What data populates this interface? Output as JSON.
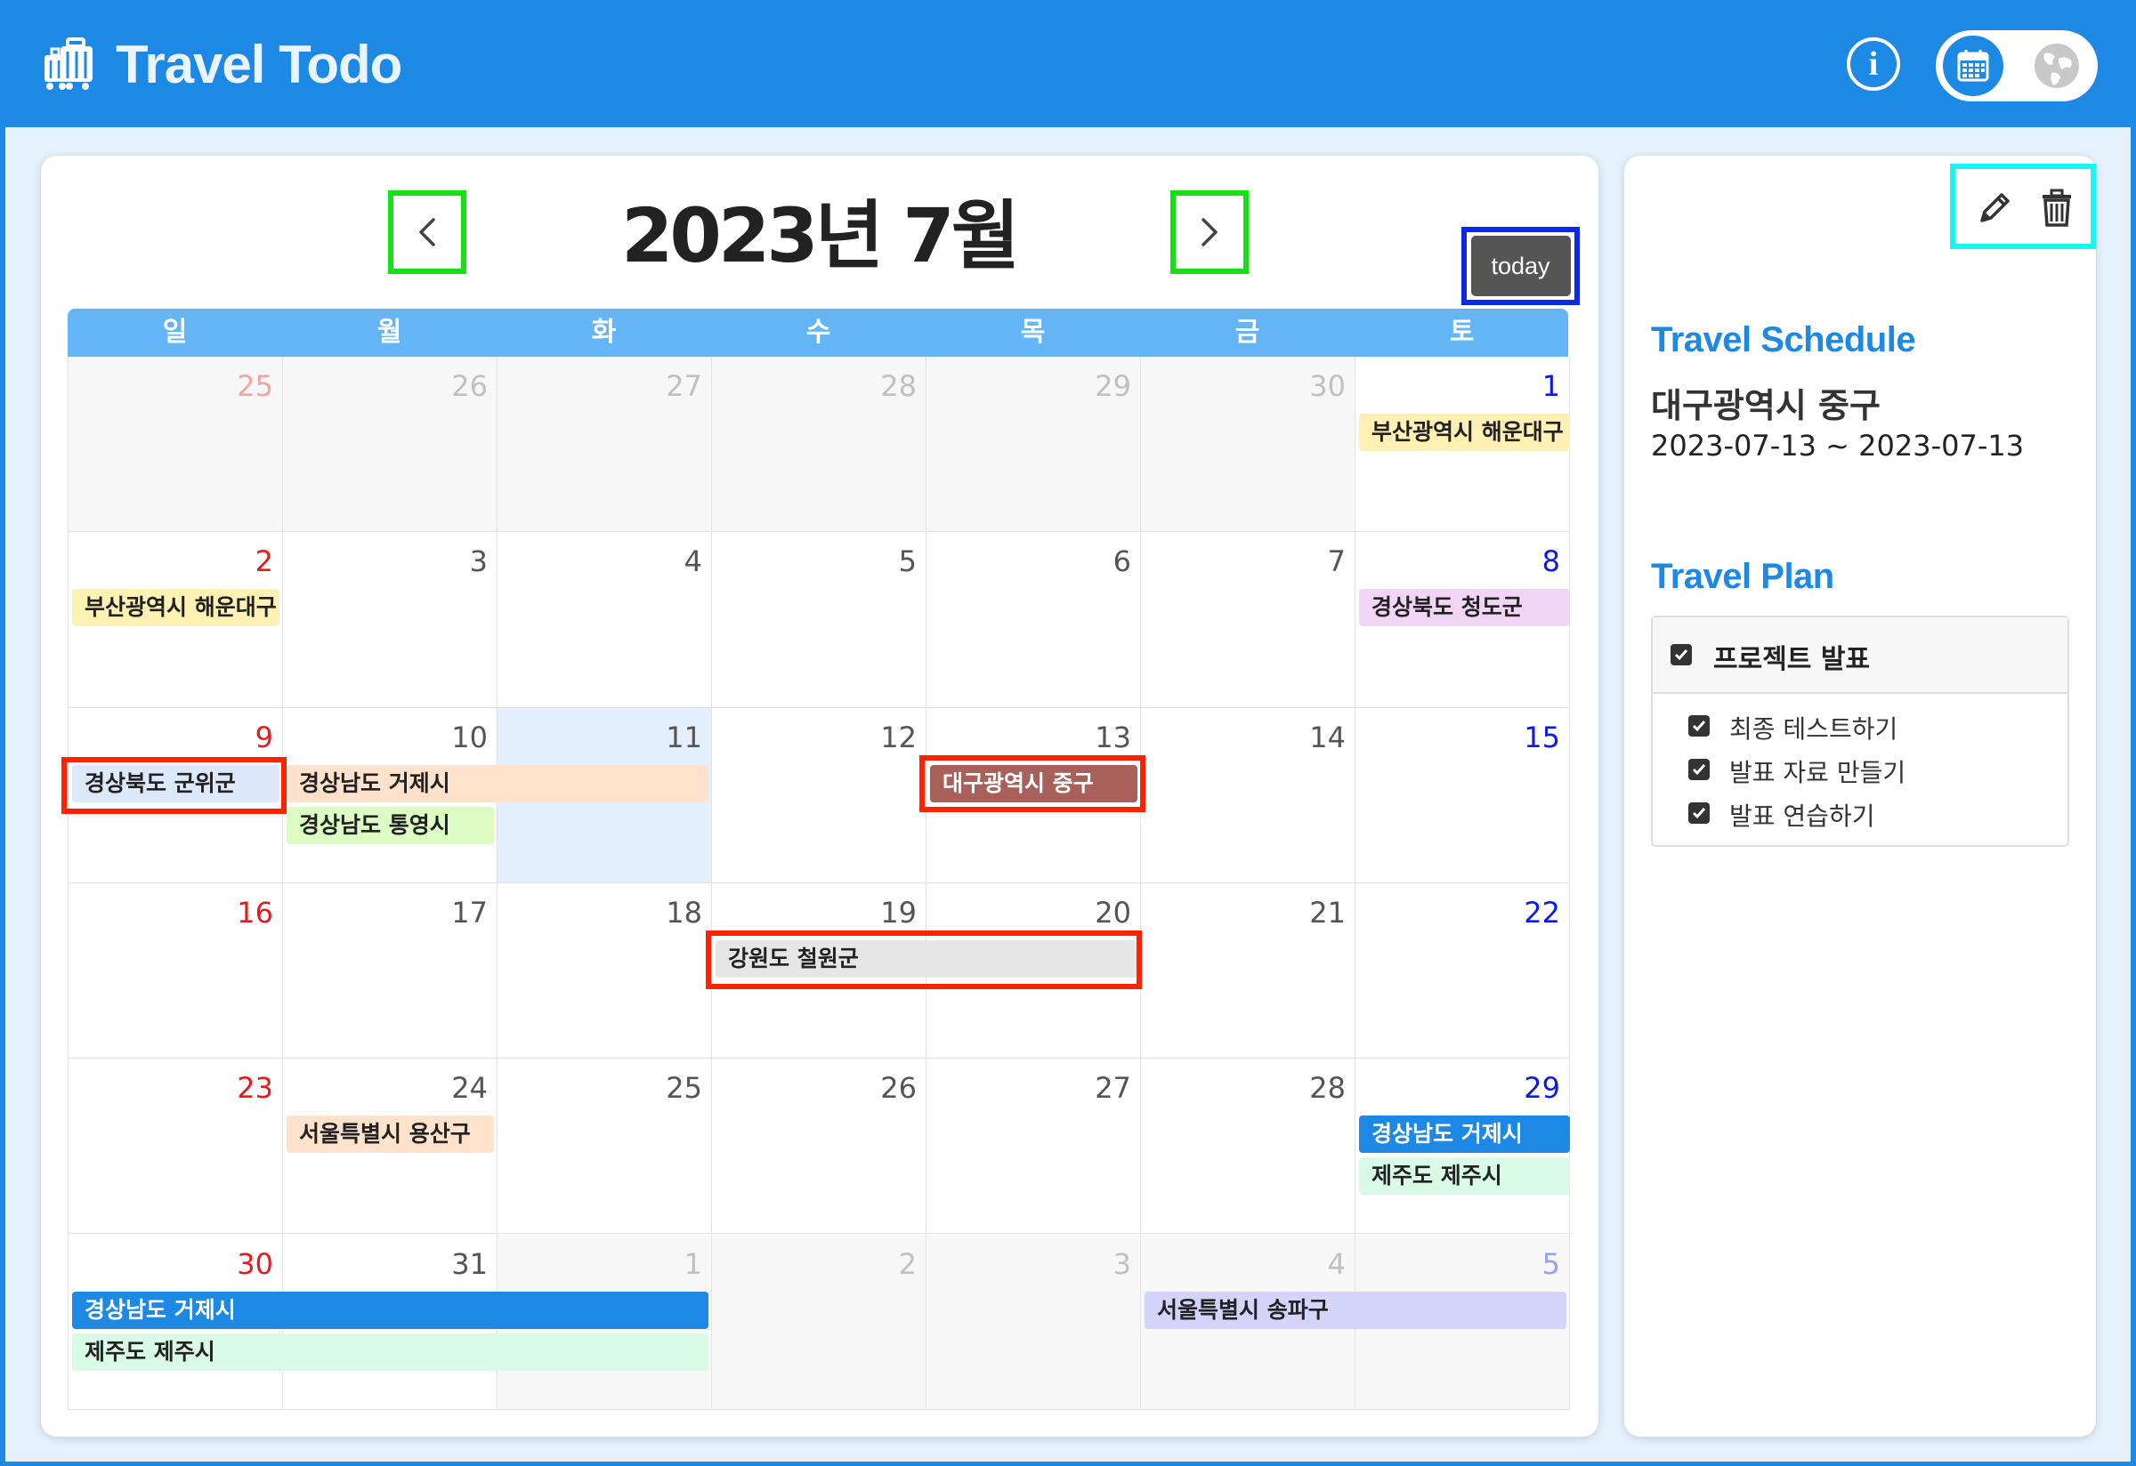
{
  "app": {
    "title": "Travel Todo"
  },
  "header": {
    "info_label": "i"
  },
  "calendar": {
    "month_title": "2023년 7월",
    "today_label": "today",
    "weekdays": [
      "일",
      "월",
      "화",
      "수",
      "목",
      "금",
      "토"
    ],
    "weeks": [
      [
        "25",
        "26",
        "27",
        "28",
        "29",
        "30",
        "1"
      ],
      [
        "2",
        "3",
        "4",
        "5",
        "6",
        "7",
        "8"
      ],
      [
        "9",
        "10",
        "11",
        "12",
        "13",
        "14",
        "15"
      ],
      [
        "16",
        "17",
        "18",
        "19",
        "20",
        "21",
        "22"
      ],
      [
        "23",
        "24",
        "25",
        "26",
        "27",
        "28",
        "29"
      ],
      [
        "30",
        "31",
        "1",
        "2",
        "3",
        "4",
        "5"
      ]
    ],
    "events": [
      {
        "label": "부산광역시 해운대구",
        "color": "#fff0b3"
      },
      {
        "label": "부산광역시 해운대구",
        "color": "#fff0b3"
      },
      {
        "label": "경상북도 청도군",
        "color": "#f2d4f7"
      },
      {
        "label": "경상북도 군위군",
        "color": "#dce9fb"
      },
      {
        "label": "경상남도 거제시",
        "color": "#ffe2cc"
      },
      {
        "label": "경상남도 통영시",
        "color": "#dcfcc4"
      },
      {
        "label": "대구광역시 중구",
        "color": "#a8605a"
      },
      {
        "label": "강원도 철원군",
        "color": "#e6e6e6"
      },
      {
        "label": "서울특별시 용산구",
        "color": "#ffe2cc"
      },
      {
        "label": "경상남도 거제시",
        "color": "#1e88e5"
      },
      {
        "label": "제주도 제주시",
        "color": "#d9fae6"
      },
      {
        "label": "경상남도 거제시",
        "color": "#1e88e5"
      },
      {
        "label": "제주도 제주시",
        "color": "#d9fae6"
      },
      {
        "label": "서울특별시 송파구",
        "color": "#d4d4fb"
      }
    ]
  },
  "sidebar": {
    "schedule_heading": "Travel Schedule",
    "schedule_title": "대구광역시 중구",
    "schedule_dates": "2023-07-13 ~ 2023-07-13",
    "plan_heading": "Travel Plan",
    "plan": {
      "title": "프로젝트 발표",
      "items": [
        "최종 테스트하기",
        "발표 자료 만들기",
        "발표 연습하기"
      ]
    }
  }
}
